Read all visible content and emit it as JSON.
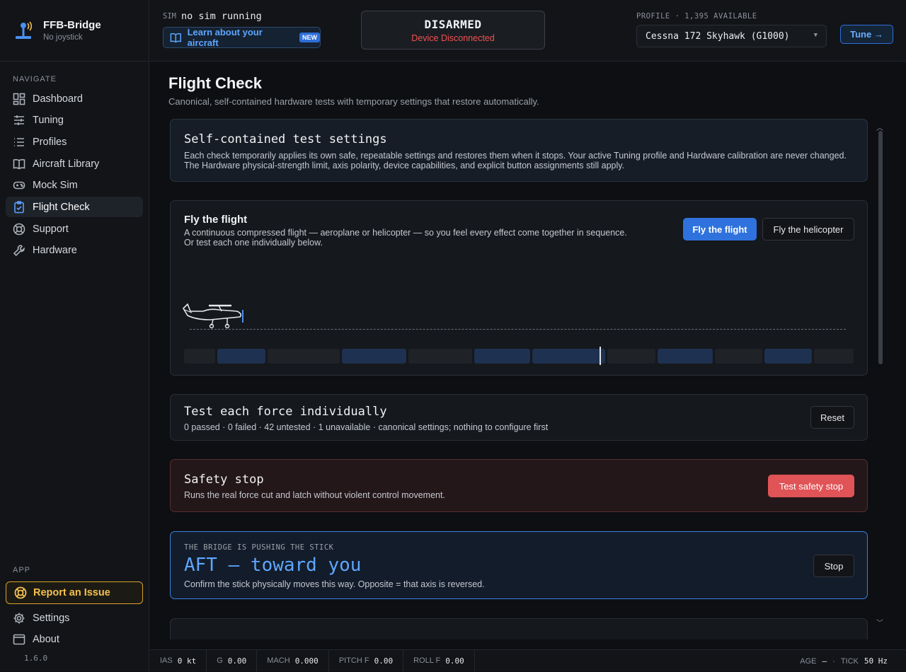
{
  "app": {
    "name": "FFB-Bridge",
    "subtitle": "No joystick",
    "version": "1.6.0"
  },
  "sidebar": {
    "navigate_label": "NAVIGATE",
    "items": [
      {
        "label": "Dashboard",
        "icon": "dashboard-icon"
      },
      {
        "label": "Tuning",
        "icon": "sliders-icon"
      },
      {
        "label": "Profiles",
        "icon": "list-icon"
      },
      {
        "label": "Aircraft Library",
        "icon": "book-icon"
      },
      {
        "label": "Mock Sim",
        "icon": "gamepad-icon"
      },
      {
        "label": "Flight Check",
        "icon": "clipboard-check-icon",
        "active": true
      },
      {
        "label": "Support",
        "icon": "lifebuoy-icon"
      },
      {
        "label": "Hardware",
        "icon": "wrench-icon"
      }
    ],
    "app_label": "APP",
    "report": "Report an Issue",
    "settings": "Settings",
    "about": "About"
  },
  "header": {
    "sim_label": "SIM",
    "sim_value": "no sim running",
    "learn_label": "Learn about your aircraft",
    "new_badge": "NEW",
    "status_title": "DISARMED",
    "status_sub": "Device Disconnected",
    "profile_label": "PROFILE · 1,395 AVAILABLE",
    "profile_value": "Cessna 172 Skyhawk (G1000)",
    "tune_label": "Tune →"
  },
  "main": {
    "title": "Flight Check",
    "subtitle": "Canonical, self-contained hardware tests with temporary settings that restore automatically.",
    "settings_card": {
      "title": "Self-contained test settings",
      "text": "Each check temporarily applies its own safe, repeatable settings and restores them when it stops. Your active Tuning profile and Hardware calibration are never changed. The Hardware physical-strength limit, axis polarity, device capabilities, and explicit button assignments still apply."
    },
    "flight_card": {
      "title": "Fly the flight",
      "line1": "A continuous compressed flight — aeroplane or helicopter — so you feel every effect come together in sequence.",
      "line2": "Or test each one individually below.",
      "btn_flight": "Fly the flight",
      "btn_heli": "Fly the helicopter"
    },
    "force_card": {
      "title": "Test each force individually",
      "summary": "0 passed · 0 failed · 42 untested · 1 unavailable · canonical settings; nothing to configure first",
      "reset": "Reset"
    },
    "safety_card": {
      "title": "Safety stop",
      "text": "Runs the real force cut and latch without violent control movement.",
      "button": "Test safety stop"
    },
    "push_card": {
      "label": "THE BRIDGE IS PUSHING THE STICK",
      "title": "AFT — toward you",
      "text": "Confirm the stick physically moves this way. Opposite = that axis is reversed.",
      "stop": "Stop"
    }
  },
  "footer": {
    "metrics": [
      {
        "k": "IAS",
        "v": "0 kt"
      },
      {
        "k": "G",
        "v": "0.00"
      },
      {
        "k": "MACH",
        "v": "0.000"
      },
      {
        "k": "PITCH F",
        "v": "0.00"
      },
      {
        "k": "ROLL F",
        "v": "0.00"
      }
    ],
    "age_label": "AGE",
    "age_value": "—",
    "dot": "·",
    "tick_label": "TICK",
    "tick_value": "50 Hz"
  },
  "colors": {
    "accent": "#2f72dd",
    "danger": "#e05356",
    "warning": "#f5c150",
    "background": "#0d0f12"
  }
}
